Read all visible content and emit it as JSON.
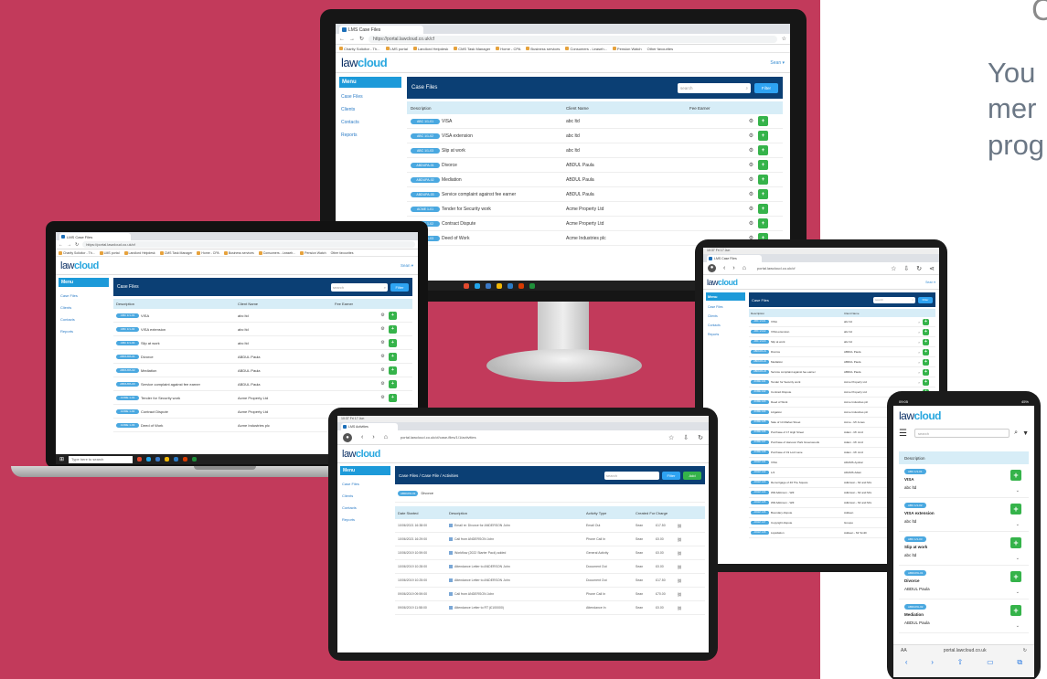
{
  "colors": {
    "background": "#c23a5b",
    "nav_dark": "#0b3f74",
    "menu_blue": "#1d9ad9",
    "table_header": "#d7edf7",
    "pill_blue": "#4aa8e0",
    "add_green": "#35b34a",
    "tagline_gray": "#6b7785"
  },
  "heading_fragment": "C",
  "tagline": [
    "You",
    "mer",
    "prog"
  ],
  "app": {
    "logo_law": "law",
    "logo_cloud": "cloud",
    "tab_title": "LMS Case Files",
    "url": "https://portal.lawcloud.co.uk/cf",
    "user": "Sean ▾",
    "menu_header": "Menu",
    "menu_items": [
      "Case Files",
      "Clients",
      "Contacts",
      "Reports"
    ],
    "case_files_title": "Case Files",
    "search_placeholder": "search",
    "filter_label": "Filter",
    "columns": [
      "Description",
      "Client Name",
      "Fee Earner"
    ],
    "case_rows": [
      {
        "ref": "ABC 1/1-01",
        "desc": "VISA",
        "client": "abc ltd",
        "earner": "Sean"
      },
      {
        "ref": "ABC 1/1-02",
        "desc": "VISA extension",
        "client": "abc ltd",
        "earner": "Sean"
      },
      {
        "ref": "ABC 1/1-03",
        "desc": "Slip at work",
        "client": "abc ltd",
        "earner": "Sean"
      },
      {
        "ref": "ABDUPA-01",
        "desc": "Divorce",
        "client": "ABDUL Paula",
        "earner": "Sean"
      },
      {
        "ref": "ABDUPA-02",
        "desc": "Mediation",
        "client": "ABDUL Paula",
        "earner": "Sean"
      },
      {
        "ref": "ABDUPA-03",
        "desc": "Service complaint against fee earner",
        "client": "ABDUL Paula",
        "earner": "Sean"
      },
      {
        "ref": "ACME 1-01",
        "desc": "Tender for Security work",
        "client": "Acme Property Ltd",
        "earner": "Sean"
      },
      {
        "ref": "ACME 1-02",
        "desc": "Contract Dispute",
        "client": "Acme Property Ltd",
        "earner": "Sean"
      },
      {
        "ref": "ACME 1-03",
        "desc": "Deed of Work",
        "client": "Acme Industries plc",
        "earner": "Sean"
      }
    ],
    "taskbar_search": "Type here to search"
  },
  "bookmarks": [
    "Charity Solicitor - Th...",
    "LMS portal",
    "Landlord Helpdesk",
    "CMS Task Manager",
    "Home - CPA",
    "Business services",
    "Consumers - Leaseh...",
    "Pension Watch"
  ],
  "other_favourites": "Other favourites",
  "tablet_activities": {
    "status_time": "10:37",
    "status_date": "Fri 17 Jun",
    "tab_title": "LMS Activities",
    "url": "portal.lawcloud.co.uk/cf/case-files/1/1/activities",
    "breadcrumb": "Case Files / Case File / Activities",
    "case_ref": "ABDUPA-01",
    "case_desc": "Divorce",
    "add_label": "Add",
    "columns": [
      "Date Started",
      "Description",
      "Activity Type",
      "Created For",
      "Charge"
    ],
    "rows": [
      {
        "date": "10/06/2021 16:38:00",
        "desc": "Email re: Divorce for ANDERSON John",
        "type": "Email Out",
        "for": "Sean",
        "charge": "£17.50"
      },
      {
        "date": "10/06/2021 16:29:00",
        "desc": "Call from ANDERSON John",
        "type": "Phone Call In",
        "for": "Sean",
        "charge": "£0.00"
      },
      {
        "date": "10/06/2019 10:59:00",
        "desc": "Workflow (2022 Starter Pack) added",
        "type": "General Activity",
        "for": "Sean",
        "charge": "£0.00"
      },
      {
        "date": "10/06/2019 10:28:00",
        "desc": "Attendance Letter to ANDERSON John",
        "type": "Document Out",
        "for": "Sean",
        "charge": "£0.00"
      },
      {
        "date": "10/06/2019 10:25:00",
        "desc": "Attendance Letter to ANDERSON John",
        "type": "Document Out",
        "for": "Sean",
        "charge": "£17.50"
      },
      {
        "date": "09/06/2019 09:59:00",
        "desc": "Call from ANDERSON John",
        "type": "Phone Call In",
        "for": "Sean",
        "charge": "£70.00"
      },
      {
        "date": "09/06/2019 11:58:00",
        "desc": "Attendance Letter to RT (£100000)",
        "type": "Attendance In",
        "for": "Sean",
        "charge": "£0.00"
      }
    ]
  },
  "tablet_list": {
    "url": "portal.lawcloud.co.uk/cf",
    "extra_rows": [
      {
        "ref": "ACME 1-04",
        "desc": "Litigation",
        "client": "Acme Industries plc"
      },
      {
        "ref": "ACME 1-05",
        "desc": "Sale of 14 Market Street",
        "client": "Acme - Mr Jones"
      },
      {
        "ref": "ACME 1-06",
        "desc": "Purchase of 17 High Street",
        "client": "Adam - Mr Jonz"
      },
      {
        "ref": "ACME 1-07",
        "desc": "Purchase of Hanover Park Greenwoods",
        "client": "Adam - Mr Jonz"
      },
      {
        "ref": "ACME 1-08",
        "desc": "Purchase of 19 Lord Lane",
        "client": "Adam - Mr Jonz"
      },
      {
        "ref": "ADAM 1-01",
        "desc": "VISA",
        "client": "ADAMS Ayobal"
      },
      {
        "ref": "ADAM 1-02",
        "desc": "L/4",
        "client": "ADAMS Adam"
      },
      {
        "ref": "ADAM 1-03",
        "desc": "Remortgage of 46 The Square",
        "client": "Adkinson - Mr and Mrs"
      },
      {
        "ref": "ADAM 1-04",
        "desc": "Will Adkinson - Will",
        "client": "Adkinson - Mr and Mrs"
      },
      {
        "ref": "ADAM 1-05",
        "desc": "Will Adkinson - Will",
        "client": "Adkinson - Mr and Mrs"
      },
      {
        "ref": "ADAM 1-06",
        "desc": "Boundary dispute",
        "client": "Addeen"
      },
      {
        "ref": "ADAM 1-07",
        "desc": "Copyright dispute",
        "client": "Groupo"
      },
      {
        "ref": "ADAM 1-08",
        "desc": "Liquidation",
        "client": "Addeen - Mr Smith"
      }
    ]
  },
  "phone": {
    "time": "09:05",
    "battery": "45%",
    "search_placeholder": "search",
    "column": "Description",
    "items": [
      {
        "ref": "ABC 1/1-01",
        "desc": "VISA",
        "client": "abc ltd"
      },
      {
        "ref": "ABC 1/1-02",
        "desc": "VISA extension",
        "client": "abc ltd"
      },
      {
        "ref": "ABC 1/1-03",
        "desc": "Slip at work",
        "client": "abc ltd"
      },
      {
        "ref": "ABDUPA-01",
        "desc": "Divorce",
        "client": "ABDUL Paula"
      },
      {
        "ref": "ABDUPA-02",
        "desc": "Mediation",
        "client": "ABDUL Paula"
      }
    ],
    "aa": "AA",
    "url": "portal.lawcloud.co.uk"
  }
}
